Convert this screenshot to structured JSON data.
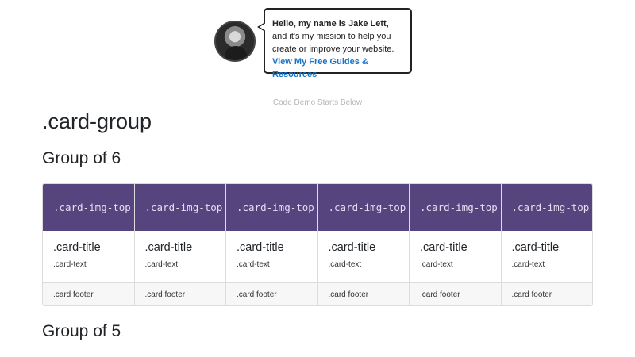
{
  "author": {
    "greeting": "Hello, my name is Jake Lett,",
    "message": " and it's my mission to help you create or improve your website. ",
    "link_label": "View My Free Guides & Resources"
  },
  "demo_note": "Code Demo Starts Below",
  "section_title": ".card-group",
  "groups": [
    {
      "title": "Group of 6"
    },
    {
      "title": "Group of 5"
    }
  ],
  "cards": [
    {
      "img_label": ".card-img-top",
      "title": ".card-title",
      "text": ".card-text",
      "footer": ".card footer"
    },
    {
      "img_label": ".card-img-top",
      "title": ".card-title",
      "text": ".card-text",
      "footer": ".card footer"
    },
    {
      "img_label": ".card-img-top",
      "title": ".card-title",
      "text": ".card-text",
      "footer": ".card footer"
    },
    {
      "img_label": ".card-img-top",
      "title": ".card-title",
      "text": ".card-text",
      "footer": ".card footer"
    },
    {
      "img_label": ".card-img-top",
      "title": ".card-title",
      "text": ".card-text",
      "footer": ".card footer"
    },
    {
      "img_label": ".card-img-top",
      "title": ".card-title",
      "text": ".card-text",
      "footer": ".card footer"
    }
  ],
  "colors": {
    "card_image_bg": "#55447e",
    "link": "#1a73c8",
    "footer_bg": "#f7f7f7"
  }
}
